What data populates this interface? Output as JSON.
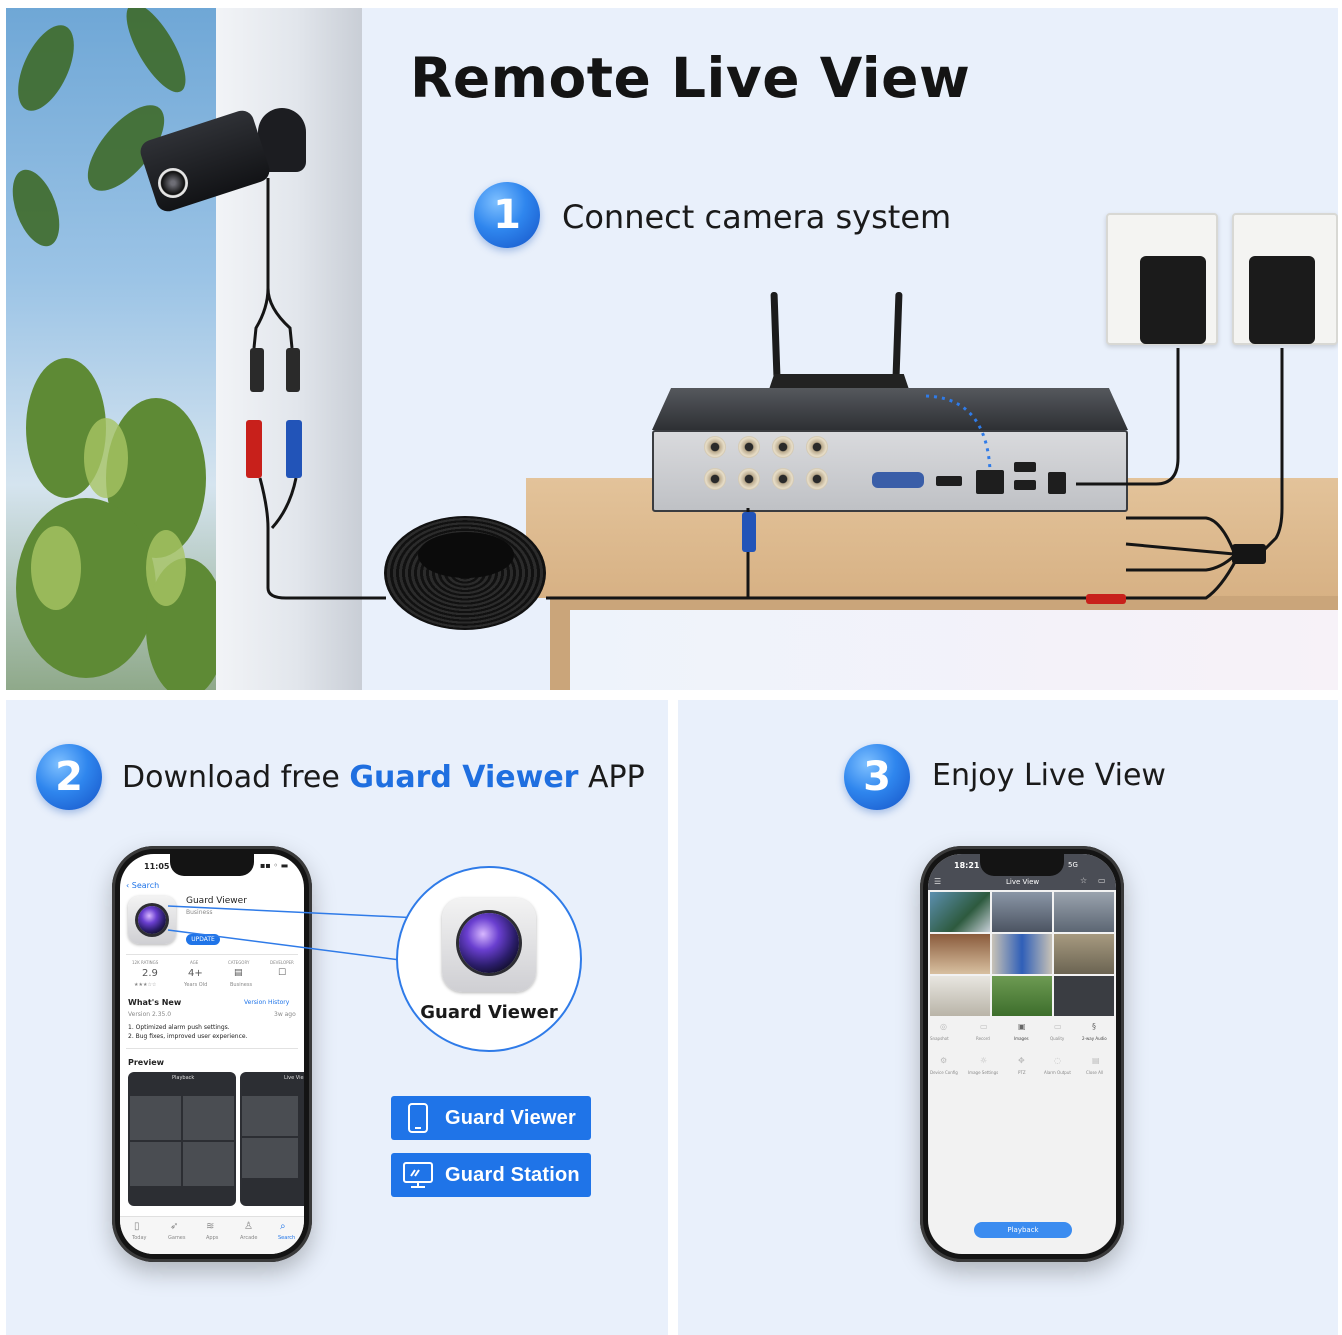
{
  "header": {
    "title": "Remote Live View"
  },
  "steps": [
    {
      "number": "1",
      "text": "Connect camera system"
    },
    {
      "number": "2",
      "text_before": "Download free ",
      "highlight": "Guard Viewer",
      "text_after": " APP"
    },
    {
      "number": "3",
      "text": "Enjoy Live View"
    }
  ],
  "colors": {
    "accent": "#1f74e8",
    "highlight_text": "#1f6fe0",
    "panel_bg": "#e9f0fb",
    "title_text": "#141414"
  },
  "app_store_phone": {
    "time": "11:05",
    "back_link": "Search",
    "app_name": "Guard Viewer",
    "app_category_sub": "Business",
    "update_button": "UPDATE",
    "stats": [
      {
        "label": "12K RATINGS",
        "value": "2.9",
        "sub": "★★★☆☆"
      },
      {
        "label": "AGE",
        "value": "4+",
        "sub": "Years Old"
      },
      {
        "label": "CATEGORY",
        "value": "",
        "sub": "Business"
      },
      {
        "label": "DEVELOPER",
        "value": "",
        "sub": ""
      }
    ],
    "whats_new": "What's New",
    "version_history": "Version History",
    "version": "Version 2.35.0",
    "version_age": "3w ago",
    "notes": [
      "1. Optimized alarm push settings.",
      "2. Bug fixes, improved user experience."
    ],
    "preview_label": "Preview",
    "preview_tab_1": "Playback",
    "preview_tab_2": "Live Vie",
    "tab_bar": [
      "Today",
      "Games",
      "Apps",
      "Arcade",
      "Search"
    ]
  },
  "zoom_icon": {
    "label": "Guard Viewer",
    "icon": "camera-lens-icon"
  },
  "download_buttons": [
    {
      "label": "Guard Viewer",
      "icon": "smartphone-icon"
    },
    {
      "label": "Guard Station",
      "icon": "monitor-icon"
    }
  ],
  "live_phone": {
    "time": "18:21",
    "signal": "5G",
    "title": "Live View",
    "toolbar_row1": [
      "Snapshot",
      "Record",
      "Images",
      "Quality",
      "2-way Audio"
    ],
    "toolbar_row2": [
      "Device Config",
      "Image Settings",
      "PTZ",
      "Alarm Output",
      "Close All"
    ],
    "playback_button": "Playback"
  }
}
